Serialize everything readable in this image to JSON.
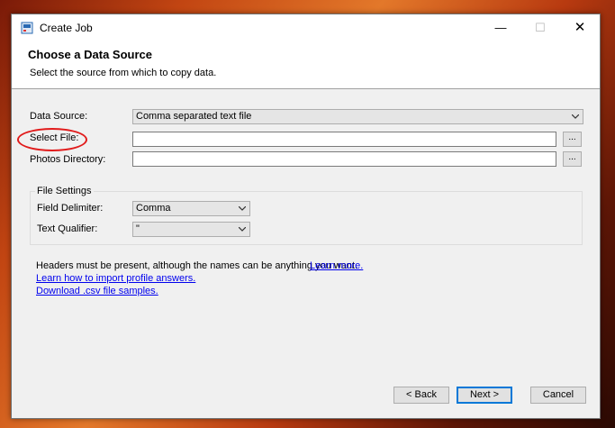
{
  "window": {
    "title": "Create Job",
    "controls": {
      "minimize": "—",
      "maximize": "☐",
      "close": "✕"
    }
  },
  "header": {
    "title": "Choose a Data Source",
    "subtitle": "Select the source from which to copy data."
  },
  "form": {
    "data_source_label": "Data Source:",
    "data_source_value": "Comma separated text file",
    "select_file_label": "Select File:",
    "select_file_value": "",
    "photos_dir_label": "Photos Directory:",
    "photos_dir_value": "",
    "browse_label": "..."
  },
  "file_settings": {
    "title": "File Settings",
    "field_delimiter_label": "Field Delimiter:",
    "field_delimiter_value": "Comma",
    "text_qualifier_label": "Text Qualifier:",
    "text_qualifier_value": "\""
  },
  "info": {
    "headers_note": "Headers must be present, although the names can be anything you want.",
    "learn_more": "Learn more.",
    "import_profile_link": "Learn how to import profile answers.",
    "download_samples_link": "Download .csv file samples."
  },
  "buttons": {
    "back": "< Back",
    "next": "Next >",
    "cancel": "Cancel"
  },
  "colors": {
    "highlight": "#e11b1b",
    "link": "#0000ee",
    "focus": "#0078d7"
  }
}
